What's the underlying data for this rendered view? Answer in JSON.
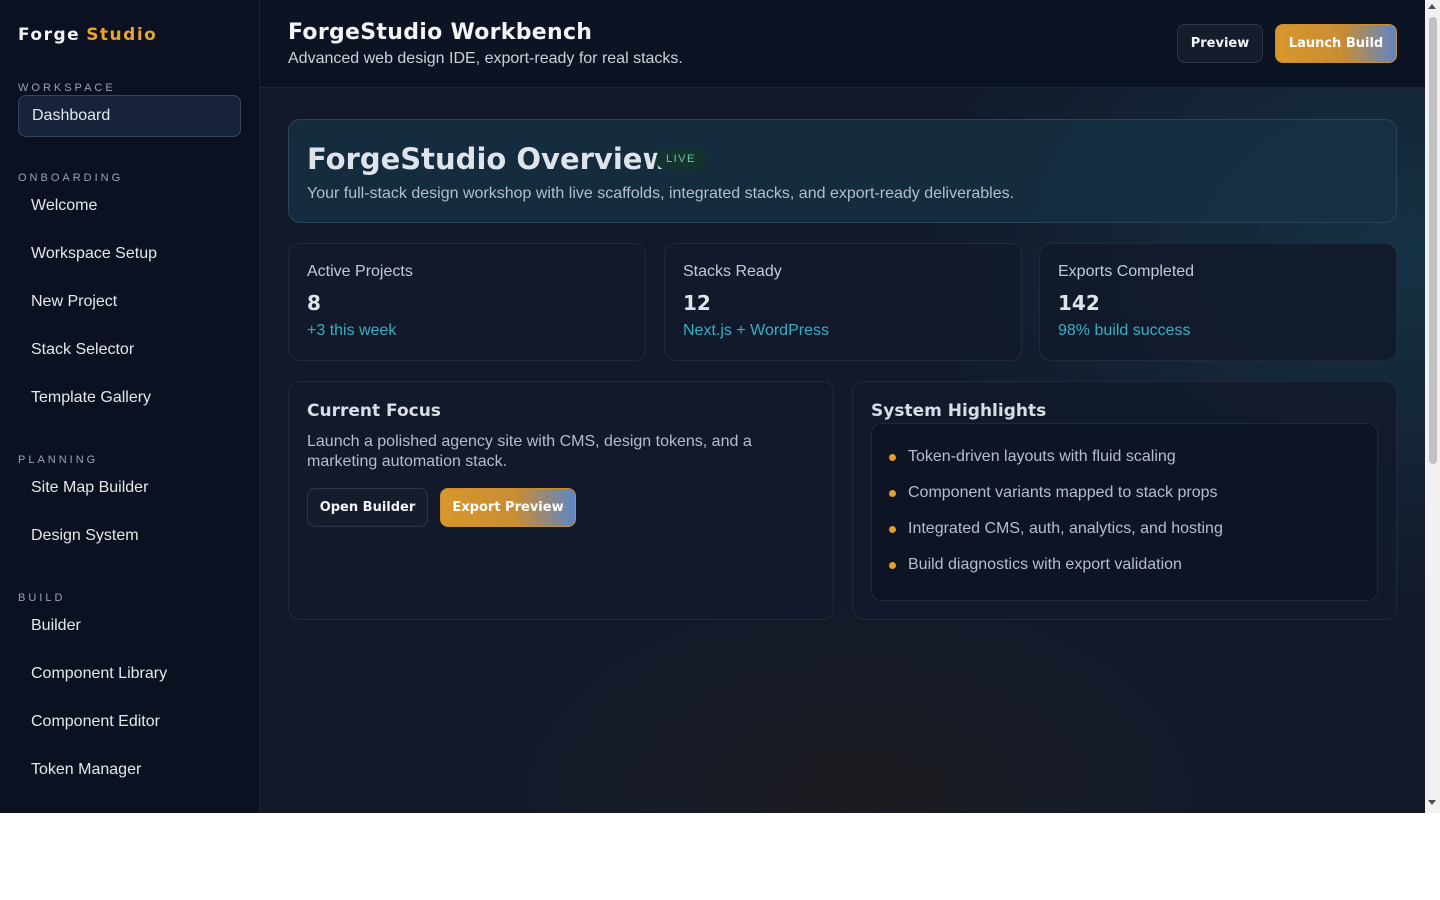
{
  "brand": {
    "name": "Forge",
    "accent": "Studio"
  },
  "sidebar": {
    "sections": [
      {
        "label": "WORKSPACE",
        "items": [
          {
            "label": "Dashboard",
            "active": true
          }
        ]
      },
      {
        "label": "ONBOARDING",
        "items": [
          {
            "label": "Welcome"
          },
          {
            "label": "Workspace Setup"
          },
          {
            "label": "New Project"
          },
          {
            "label": "Stack Selector"
          },
          {
            "label": "Template Gallery"
          }
        ]
      },
      {
        "label": "PLANNING",
        "items": [
          {
            "label": "Site Map Builder"
          },
          {
            "label": "Design System"
          }
        ]
      },
      {
        "label": "BUILD",
        "items": [
          {
            "label": "Builder"
          },
          {
            "label": "Component Library"
          },
          {
            "label": "Component Editor"
          },
          {
            "label": "Token Manager"
          }
        ]
      }
    ]
  },
  "header": {
    "title": "ForgeStudio Workbench",
    "subtitle": "Advanced web design IDE, export-ready for real stacks.",
    "preview_label": "Preview",
    "launch_label": "Launch Build"
  },
  "overview": {
    "title": "ForgeStudio Overview",
    "badge": "LIVE",
    "description": "Your full-stack design workshop with live scaffolds, integrated stacks, and export-ready deliverables."
  },
  "stats": [
    {
      "label": "Active Projects",
      "value": "8",
      "note": "+3 this week"
    },
    {
      "label": "Stacks Ready",
      "value": "12",
      "note": "Next.js + WordPress"
    },
    {
      "label": "Exports Completed",
      "value": "142",
      "note": "98% build success"
    }
  ],
  "focus": {
    "title": "Current Focus",
    "description": "Launch a polished agency site with CMS, design tokens, and a marketing automation stack.",
    "open_label": "Open Builder",
    "export_label": "Export Preview"
  },
  "highlights": {
    "title": "System Highlights",
    "items": [
      "Token-driven layouts with fluid scaling",
      "Component variants mapped to stack props",
      "Integrated CMS, auth, analytics, and hosting",
      "Build diagnostics with export validation"
    ]
  },
  "colors": {
    "accent": "#e8a330",
    "teal": "#32b1c4",
    "live": "#6cc7a4"
  }
}
